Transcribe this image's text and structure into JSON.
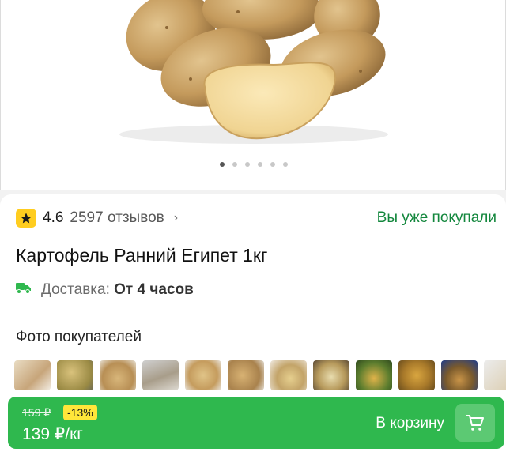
{
  "product": {
    "rating": "4.6",
    "reviews": "2597 отзывов",
    "already_bought": "Вы уже покупали",
    "title": "Картофель Ранний Египет 1кг",
    "delivery_label": "Доставка:",
    "delivery_value": "От 4 часов"
  },
  "gallery": {
    "dots": 6,
    "active_index": 0
  },
  "photos": {
    "title": "Фото покупателей",
    "count": 12
  },
  "cart": {
    "old_price": "159 ₽",
    "discount": "-13%",
    "price": "139 ₽/кг",
    "button_label": "В корзину"
  },
  "colors": {
    "accent_green": "#2fb84e",
    "link_green": "#13873d",
    "star_yellow": "#ffcd1f",
    "discount_yellow": "#ffe63a"
  },
  "icons": [
    "star-icon",
    "chevron-right-icon",
    "delivery-truck-icon",
    "cart-icon"
  ]
}
